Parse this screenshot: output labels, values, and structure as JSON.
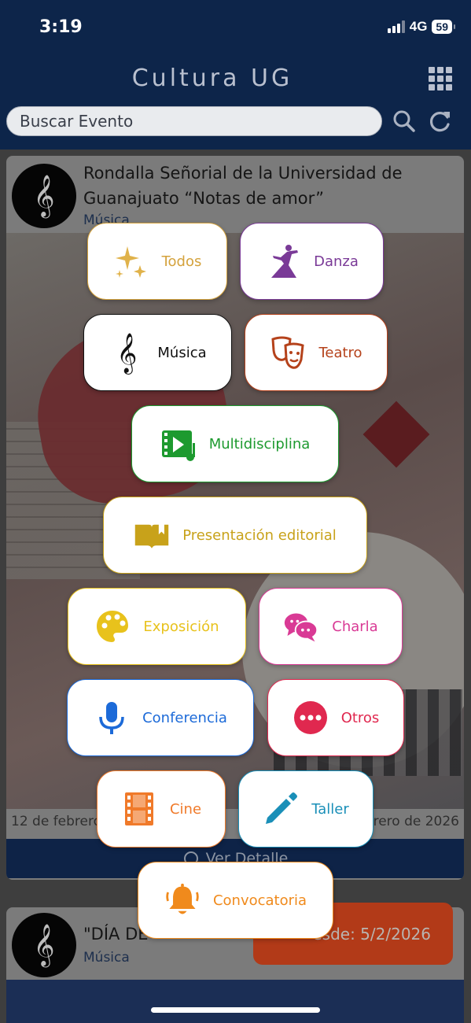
{
  "status_bar": {
    "time": "3:19",
    "network": "4G",
    "battery": "59"
  },
  "header": {
    "title": "Cultura UG",
    "search_placeholder": "Buscar Evento"
  },
  "events": [
    {
      "title": "Rondalla Señorial de la Universidad de Guanajuato “Notas de amor”",
      "category": "Música",
      "date_start": "12 de febrero",
      "date_end": "rero de 2026",
      "detail_label": "Ver Detalle"
    },
    {
      "title": "\"DÍA DE",
      "category": "Música"
    }
  ],
  "date_fab": {
    "label": "esde: 5/2/2026"
  },
  "categories": [
    {
      "label": "Todos",
      "color": "#d4a23c",
      "icon": "sparkles-icon"
    },
    {
      "label": "Danza",
      "color": "#7a3a97",
      "icon": "dancer-icon"
    },
    {
      "label": "Música",
      "color": "#111111",
      "icon": "treble-clef-icon"
    },
    {
      "label": "Teatro",
      "color": "#b5421b",
      "icon": "theater-masks-icon"
    },
    {
      "label": "Multidisciplina",
      "color": "#1d9a2f",
      "icon": "multimedia-icon"
    },
    {
      "label": "Presentación editorial",
      "color": "#c8a21a",
      "icon": "open-book-icon"
    },
    {
      "label": "Exposición",
      "color": "#e8c21c",
      "icon": "palette-icon"
    },
    {
      "label": "Charla",
      "color": "#d93a95",
      "icon": "chat-bubbles-icon"
    },
    {
      "label": "Conferencia",
      "color": "#1c6ad8",
      "icon": "microphone-icon"
    },
    {
      "label": "Otros",
      "color": "#e0284f",
      "icon": "more-dots-icon"
    },
    {
      "label": "Cine",
      "color": "#f07a2a",
      "icon": "film-icon"
    },
    {
      "label": "Taller",
      "color": "#1a8fb8",
      "icon": "pencil-icon"
    },
    {
      "label": "Convocatoria",
      "color": "#f08a1c",
      "icon": "bell-icon"
    }
  ]
}
